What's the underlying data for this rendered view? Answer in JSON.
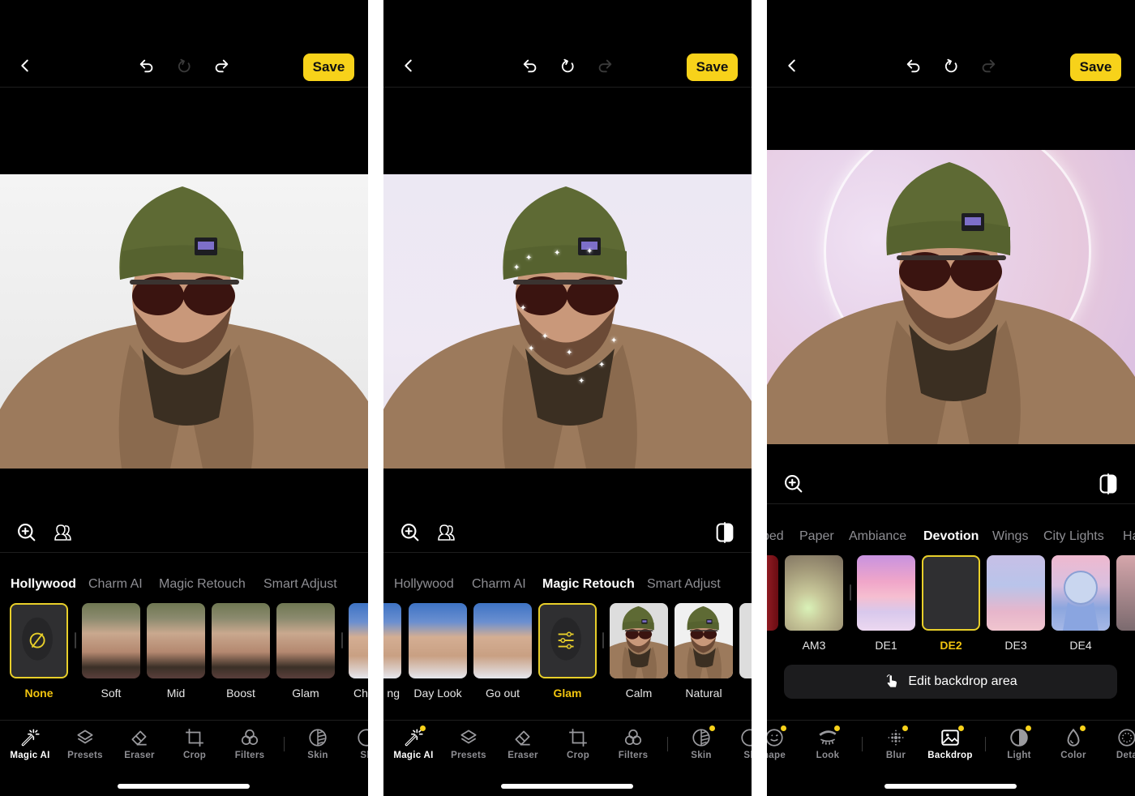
{
  "colors": {
    "accent": "#f7d21a",
    "background": "#000000",
    "inactive_text": "#8e8e93"
  },
  "panels": [
    {
      "header": {
        "save_label": "Save",
        "back_icon": "chevron-left-icon",
        "undo_icon": "undo-icon",
        "reset_icon": "reset-icon",
        "redo_icon": "redo-icon",
        "reset_enabled": false,
        "redo_enabled": true
      },
      "tools": {
        "zoom_icon": "zoom-in-icon",
        "faces_icon": "face-select-icon"
      },
      "categories": [
        "Hollywood",
        "Charm AI",
        "Magic Retouch",
        "Smart Adjust"
      ],
      "active_category": "Hollywood",
      "thumbnails": [
        {
          "label": "None",
          "selected": true
        },
        {
          "label": "Soft"
        },
        {
          "label": "Mid"
        },
        {
          "label": "Boost"
        },
        {
          "label": "Glam"
        },
        {
          "label": "Ch"
        }
      ],
      "bottom_nav": [
        {
          "label": "Magic AI",
          "icon": "magic-wand-icon",
          "active": true
        },
        {
          "label": "Presets",
          "icon": "layers-icon"
        },
        {
          "label": "Eraser",
          "icon": "eraser-icon"
        },
        {
          "label": "Crop",
          "icon": "crop-icon"
        },
        {
          "label": "Filters",
          "icon": "filters-icon"
        },
        {
          "label": "Skin",
          "icon": "skin-icon"
        },
        {
          "label": "Sh",
          "icon": "shape-icon"
        }
      ]
    },
    {
      "header": {
        "save_label": "Save",
        "reset_enabled": true,
        "redo_enabled": false
      },
      "tools": {
        "zoom_icon": "zoom-in-icon",
        "faces_icon": "face-select-icon",
        "compare_icon": "compare-icon"
      },
      "categories": [
        "Hollywood",
        "Charm AI",
        "Magic Retouch",
        "Smart Adjust"
      ],
      "active_category": "Magic Retouch",
      "thumbnails": [
        {
          "label": "ng"
        },
        {
          "label": "Day Look"
        },
        {
          "label": "Go out"
        },
        {
          "label": "Glam",
          "selected": true
        },
        {
          "label": "Calm"
        },
        {
          "label": "Natural"
        }
      ],
      "bottom_nav": [
        {
          "label": "Magic AI",
          "active": true,
          "dot": true
        },
        {
          "label": "Presets"
        },
        {
          "label": "Eraser"
        },
        {
          "label": "Crop"
        },
        {
          "label": "Filters"
        },
        {
          "label": "Skin",
          "dot": true
        },
        {
          "label": "Sh"
        }
      ]
    },
    {
      "header": {
        "save_label": "Save",
        "reset_enabled": true,
        "redo_enabled": false
      },
      "tools": {
        "zoom_icon": "zoom-in-icon",
        "compare_icon": "compare-icon"
      },
      "categories": [
        "bed",
        "Paper",
        "Ambiance",
        "Devotion",
        "Wings",
        "City Lights",
        "Ha"
      ],
      "active_category": "Devotion",
      "thumbnails": [
        {
          "label": "AM3"
        },
        {
          "label": "DE1"
        },
        {
          "label": "DE2",
          "selected": true
        },
        {
          "label": "DE3"
        },
        {
          "label": "DE4"
        }
      ],
      "edit_area_label": "Edit backdrop area",
      "bottom_nav": [
        {
          "label": "hape",
          "dot": true
        },
        {
          "label": "Look",
          "dot": true
        },
        {
          "label": "Blur",
          "dot": true
        },
        {
          "label": "Backdrop",
          "active": true,
          "dot": true
        },
        {
          "label": "Light",
          "dot": true
        },
        {
          "label": "Color",
          "dot": true
        },
        {
          "label": "Deta"
        }
      ]
    }
  ]
}
